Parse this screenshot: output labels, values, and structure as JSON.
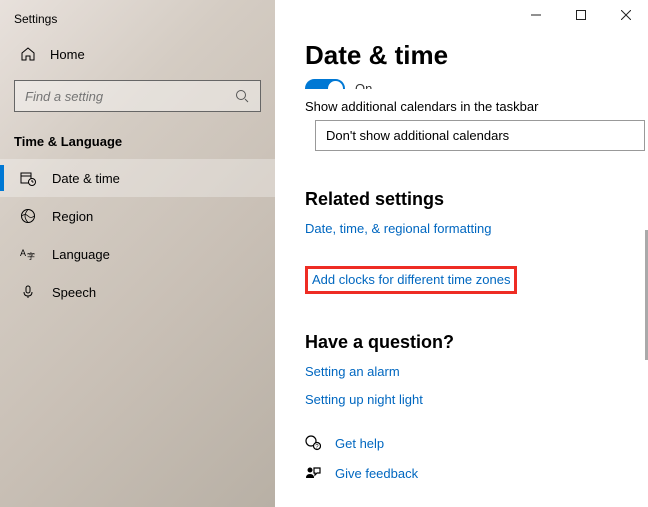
{
  "window": {
    "title": "Settings"
  },
  "sidebar": {
    "home": "Home",
    "search_placeholder": "Find a setting",
    "category": "Time & Language",
    "items": [
      {
        "label": "Date & time"
      },
      {
        "label": "Region"
      },
      {
        "label": "Language"
      },
      {
        "label": "Speech"
      }
    ]
  },
  "main": {
    "title": "Date & time",
    "toggle_state": "On",
    "additional_cal_label": "Show additional calendars in the taskbar",
    "additional_cal_value": "Don't show additional calendars",
    "related_heading": "Related settings",
    "link_formatting": "Date, time, & regional formatting",
    "link_clocks": "Add clocks for different time zones",
    "question_heading": "Have a question?",
    "link_alarm": "Setting an alarm",
    "link_night": "Setting up night light",
    "link_help": "Get help",
    "link_feedback": "Give feedback"
  }
}
